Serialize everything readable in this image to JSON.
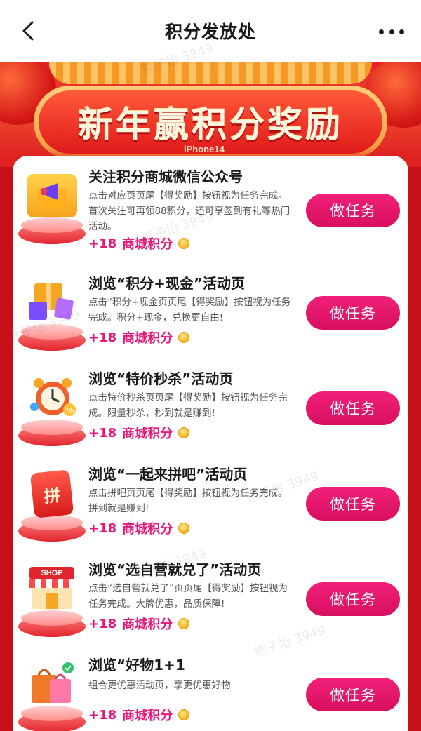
{
  "nav": {
    "title": "积分发放处",
    "back_icon": "chevron-left-icon",
    "more_icon": "more-horizontal-icon"
  },
  "banner": {
    "title": "新年赢积分奖励",
    "tag": "iPhone14"
  },
  "watermark": "熊子怡 3949",
  "colors": {
    "brand_red": "#c8101a",
    "button_pink": "#e5177a",
    "reward_pink": "#e5177a"
  },
  "tasks": [
    {
      "title": "关注积分商城微信公众号",
      "desc": "点击对应页页尾【得奖励】按钮视为任务完成。首次关注可再领88积分，还可享签到有礼等热门活动。",
      "reward": "+18",
      "reward_unit": "商城积分",
      "button": "做任务",
      "icon": "megaphone-envelope-icon"
    },
    {
      "title": "浏览“积分+现金”活动页",
      "desc": "点击“积分+现金页页尾【得奖励】按钮视为任务完成。积分+现金，兑换更自由!",
      "reward": "+18",
      "reward_unit": "商城积分",
      "button": "做任务",
      "icon": "package-boxes-icon"
    },
    {
      "title": "浏览“特价秒杀”活动页",
      "desc": "点击特价秒杀页页尾【得奖励】按钮视为任务完成。限量秒杀，秒到就是赚到!",
      "reward": "+18",
      "reward_unit": "商城积分",
      "button": "做任务",
      "icon": "alarm-clock-icon"
    },
    {
      "title": "浏览“一起来拼吧”活动页",
      "desc": "点击拼吧页页尾【得奖励】按钮视为任务完成。拼到就是赚到!",
      "reward": "+18",
      "reward_unit": "商城积分",
      "button": "做任务",
      "icon": "group-buy-envelope-icon",
      "icon_text": "拼"
    },
    {
      "title": "浏览“选自营就兑了”活动页",
      "desc": "点击“选自营就兑了”页页尾【得奖励】按钮视为任务完成。大牌优惠，品质保障!",
      "reward": "+18",
      "reward_unit": "商城积分",
      "button": "做任务",
      "icon": "shop-storefront-icon",
      "icon_text": "SHOP"
    },
    {
      "title": "浏览“好物1+1",
      "desc": "组合更优惠活动页，享更优惠好物",
      "reward": "+18",
      "reward_unit": "商城积分",
      "button": "做任务",
      "icon": "shopping-bags-icon"
    }
  ]
}
